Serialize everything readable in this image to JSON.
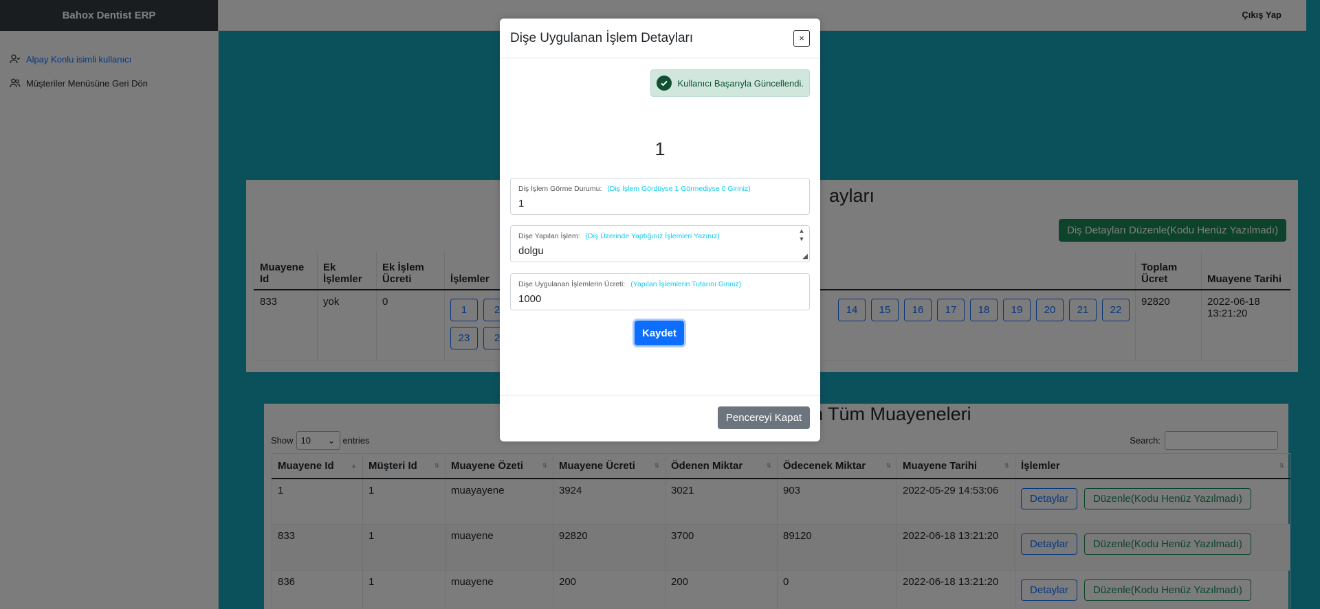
{
  "app": {
    "brand": "Bahox Dentist ERP",
    "logout": "Çıkış Yap"
  },
  "sidebar": {
    "items": [
      {
        "label": "Alpay Konlu isimli kullanıcı",
        "icon": "user-check-icon"
      },
      {
        "label": "Müşteriler Menüsüne Geri Dön",
        "icon": "users-icon"
      }
    ]
  },
  "panel1": {
    "title_partial": "ayları",
    "edit_button": "Diş Detayları Düzenle(Kodu Henüz Yazılmadı)",
    "headers": [
      "Muayene Id",
      "Ek İşlemler",
      "Ek İşlem Ücreti",
      "İşlemler",
      "Toplam Ücret",
      "Muayene Tarihi"
    ],
    "row": {
      "id": "833",
      "extra": "yok",
      "extra_fee": "0",
      "total": "92820",
      "date": "2022-06-18 13:21:20"
    },
    "teeth_left": [
      "1",
      "2"
    ],
    "teeth_right": [
      "14",
      "15",
      "16",
      "17",
      "18",
      "19",
      "20",
      "21",
      "22"
    ],
    "teeth_row2": [
      "23",
      "2"
    ]
  },
  "panel2": {
    "title_partial": "n Tüm Muayeneleri",
    "show_label": "Show",
    "entries_label": "entries",
    "page_size": "10",
    "search_label": "Search:",
    "headers": [
      "Muayene Id",
      "Müşteri Id",
      "Muayene Özeti",
      "Muayene Ücreti",
      "Ödenen Miktar",
      "Ödecenek Miktar",
      "Muayene Tarihi",
      "İşlemler"
    ],
    "rows": [
      [
        "1",
        "1",
        "muayayene",
        "3924",
        "3021",
        "903",
        "2022-05-29 14:53:06"
      ],
      [
        "833",
        "1",
        "muayene",
        "92820",
        "3700",
        "89120",
        "2022-06-18 13:21:20"
      ],
      [
        "836",
        "1",
        "muayene",
        "200",
        "200",
        "0",
        "2022-06-18 13:21:20"
      ]
    ],
    "details_label": "Detaylar",
    "edit_label": "Düzenle(Kodu Henüz Yazılmadı)"
  },
  "modal": {
    "title": "Dişe Uygulanan İşlem Detayları",
    "close_symbol": "×",
    "alert": "Kullanıcı Başarıyla Güncellendi.",
    "tooth_number": "1",
    "fields": [
      {
        "label": "Diş İşlem Görme Durumu:",
        "hint": "(Diş İşlem Gördüyse 1 Görmediyse 0 Giriniz)",
        "value": "1"
      },
      {
        "label": "Dişe Yapılan İşlem:",
        "hint": "(Diş Üzerinde Yaptığınız İşlemleri Yazınız)",
        "value": "dolgu"
      },
      {
        "label": "Dişe Uygulanan İşlemlerin Ücreti:",
        "hint": "(Yapılan İşlemlerin Tutarını Giriniz)",
        "value": "1000"
      }
    ],
    "save": "Kaydet",
    "close_window": "Pencereyi Kapat"
  },
  "colors": {
    "primary": "#0d6efd",
    "success": "#198754",
    "info_bg": "#17a2b8",
    "secondary": "#6c757d"
  }
}
